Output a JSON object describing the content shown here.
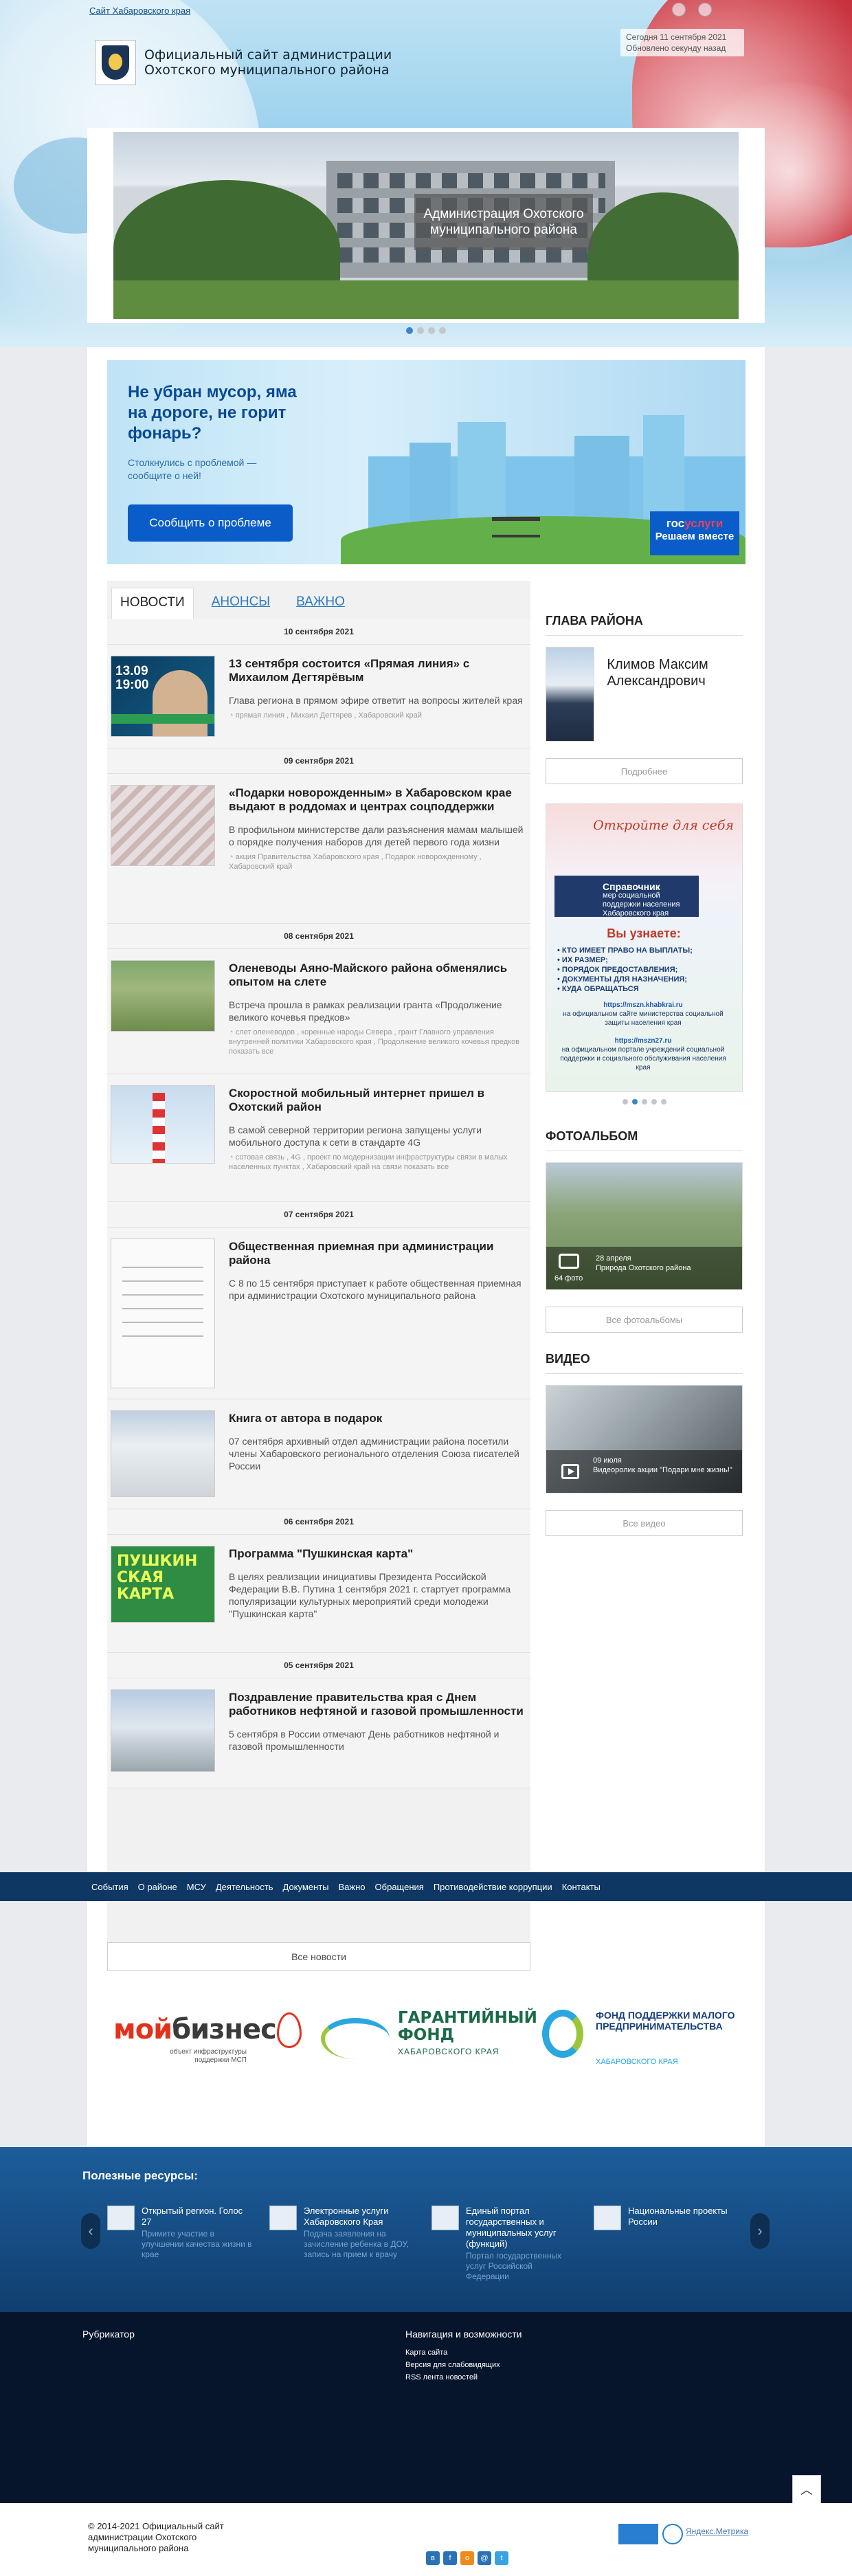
{
  "header": {
    "top_link": "Сайт Хабаровского края",
    "site_title": "Официальный сайт администрации Охотского муниципального района",
    "date_line": "Сегодня 11 сентября 2021",
    "updated_line": "Обновлено секунду назад"
  },
  "slider": {
    "caption": "Администрация Охотского муниципального района"
  },
  "banner": {
    "headline": "Не убран мусор, яма на дороге, не горит фонарь?",
    "sub": "Столкнулись с проблемой — сообщите о ней!",
    "button": "Сообщить о проблеме",
    "gos_1a": "гос",
    "gos_1b": "услуги",
    "gos_2": "Решаем вместе"
  },
  "news": {
    "tabs": [
      "НОВОСТИ",
      "АНОНСЫ",
      "ВАЖНО"
    ],
    "dates": [
      "10 сентября 2021",
      "09 сентября 2021",
      "08 сентября 2021",
      "07 сентября 2021",
      "06 сентября 2021",
      "05 сентября 2021"
    ],
    "items": [
      {
        "thumb_text": "13.09\n19:00",
        "title": "13 сентября состоится «Прямая линия» с Михаилом Дегтярёвым",
        "desc": "Глава региона в прямом эфире ответит на вопросы жителей края",
        "tags": "прямая линия , Михаил Дегтярев , Хабаровский край"
      },
      {
        "title": "«Подарки новорожденным» в Хабаровском крае выдают в роддомах и центрах соцподдержки",
        "desc": "В профильном министерстве дали разъяснения мамам малышей о порядке получения наборов для детей первого года жизни",
        "tags": "акция Правительства Хабаровского края , Подарок новорожденному , Хабаровский край"
      },
      {
        "title": "Оленеводы Аяно-Майского района обменялись опытом на слете",
        "desc": "Встреча прошла в рамках реализации гранта «Продолжение великого кочевья предков»",
        "tags": "слет оленеводов , коренные народы Севера , грант Главного управления внутренней политики Хабаровского края , Продолжение великого кочевья предков показать все"
      },
      {
        "title": "Скоростной мобильный интернет пришел в Охотский район",
        "desc": "В самой северной территории региона запущены услуги мобильного доступа к сети в стандарте 4G",
        "tags": "сотовая связь , 4G , проект по модернизации инфраструктуры связи в малых населенных пунктах , Хабаровский край на связи показать все"
      },
      {
        "title": "Общественная приемная при администрации района",
        "desc": "С 8 по 15 сентября приступает к работе общественная приемная при администрации Охотского муниципального района",
        "tags": ""
      },
      {
        "title": "Книга от автора в подарок",
        "desc": "07 сентября архивный отдел администрации района посетили члены Хабаровского регионального отделения Союза писателей России",
        "tags": ""
      },
      {
        "thumb_text": "ПУШКИН\nСКАЯ\nКАРТА",
        "title": "Программа \"Пушкинская карта\"",
        "desc": "В целях реализации инициативы Президента Российской Федерации В.В. Путина 1 сентября 2021 г. стартует программа популяризации культурных мероприятий среди молодежи \"Пушкинская карта\"",
        "tags": ""
      },
      {
        "title": "Поздравление правительства края с Днем работников нефтяной и газовой промышленности",
        "desc": "5 сентября в России отмечают День работников нефтяной и газовой промышленности",
        "tags": ""
      }
    ],
    "all_button": "Все новости"
  },
  "sidebar": {
    "head_title": "ГЛАВА РАЙОНА",
    "head_name": "Климов Максим Александрович",
    "head_more": "Подробнее",
    "promo": {
      "open": "Откройте для себя",
      "guide_title": "Справочник",
      "guide_sub": "мер социальной поддержки населения Хабаровского края",
      "learn": "Вы узнаете:",
      "list": [
        "• КТО ИМЕЕТ ПРАВО НА ВЫПЛАТЫ;",
        "• ИХ РАЗМЕР;",
        "• ПОРЯДОК ПРЕДОСТАВЛЕНИЯ;",
        "• ДОКУМЕНТЫ ДЛЯ НАЗНАЧЕНИЯ;",
        "• КУДА ОБРАЩАТЬСЯ"
      ],
      "url1": "https://mszn.khabkrai.ru",
      "text1": "на официальном сайте министерства социальной защиты населения края",
      "url2": "https://mszn27.ru",
      "text2": "на официальном портале учреждений социальной поддержки и социального обслуживания населения края"
    },
    "album_title": "ФОТОАЛЬБОМ",
    "album_date": "28 апреля",
    "album_name": "Природа Охотского района",
    "album_count": "64 фото",
    "album_all": "Все фотоальбомы",
    "video_title": "ВИДЕО",
    "video_date": "09 июля",
    "video_name": "Видеоролик акции \"Подари мне жизнь!\"",
    "video_all": "Все видео"
  },
  "navbar": [
    "События",
    "О районе",
    "МСУ",
    "Деятельность",
    "Документы",
    "Важно",
    "Обращения",
    "Противодействие коррупции",
    "Контакты"
  ],
  "partners": {
    "moi_a": "мой",
    "moi_b": "бизнес",
    "moi_sub": "объект инфраструктуры поддержки МСП",
    "gar": "ГАРАНТИЙНЫЙ ФОНД",
    "gar_sub": "ХАБАРОВСКОГО КРАЯ",
    "fond": "ФОНД ПОДДЕРЖКИ МАЛОГО ПРЕДПРИНИМАТЕЛЬСТВА",
    "fond_sub": "ХАБАРОВСКОГО КРАЯ"
  },
  "resources": {
    "title": "Полезные ресурсы:",
    "items": [
      {
        "title": "Открытый регион. Голос 27",
        "desc": "Примите участие в улучшении качества жизни в крае"
      },
      {
        "title": "Электронные услуги Хабаровского Края",
        "desc": "Подача заявления на зачисление ребенка в ДОУ, запись на прием к врачу"
      },
      {
        "title": "Единый портал государственных и муниципальных услуг (функций)",
        "desc": "Портал государственных услуг Российской Федерации"
      },
      {
        "title": "Национальные проекты России",
        "desc": ""
      }
    ]
  },
  "footer": {
    "rubricator": "Рубрикатор",
    "nav_title": "Навигация и возможности",
    "links": [
      "Карта сайта",
      "Версия для слабовидящих",
      "RSS лента новостей"
    ],
    "copyright": "© 2014-2021 Официальный сайт администрации Охотского муниципального района",
    "metrika": "Яндекс.Метрика"
  }
}
